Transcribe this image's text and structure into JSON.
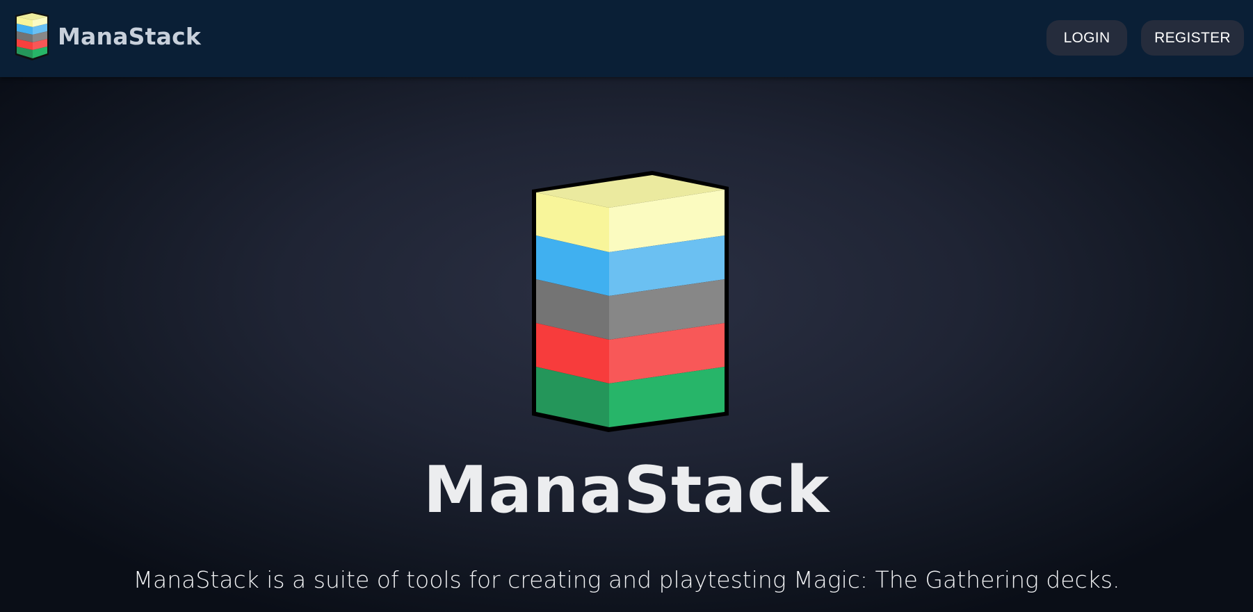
{
  "header": {
    "brand_name": "ManaStack",
    "logo_icon": "stack-logo-icon",
    "nav": {
      "login_label": "LOGIN",
      "register_label": "REGISTER"
    }
  },
  "hero": {
    "logo_icon": "stack-logo-icon",
    "title": "ManaStack",
    "tagline": "ManaStack is a suite of tools for creating and playtesting Magic: The Gathering decks."
  },
  "colors": {
    "header_bg": "#0a1f36",
    "button_bg": "#252c3c",
    "stack_yellow": "#f8f59a",
    "stack_blue": "#42b0f0",
    "stack_gray": "#767676",
    "stack_red": "#f7403e",
    "stack_green": "#25965a"
  }
}
